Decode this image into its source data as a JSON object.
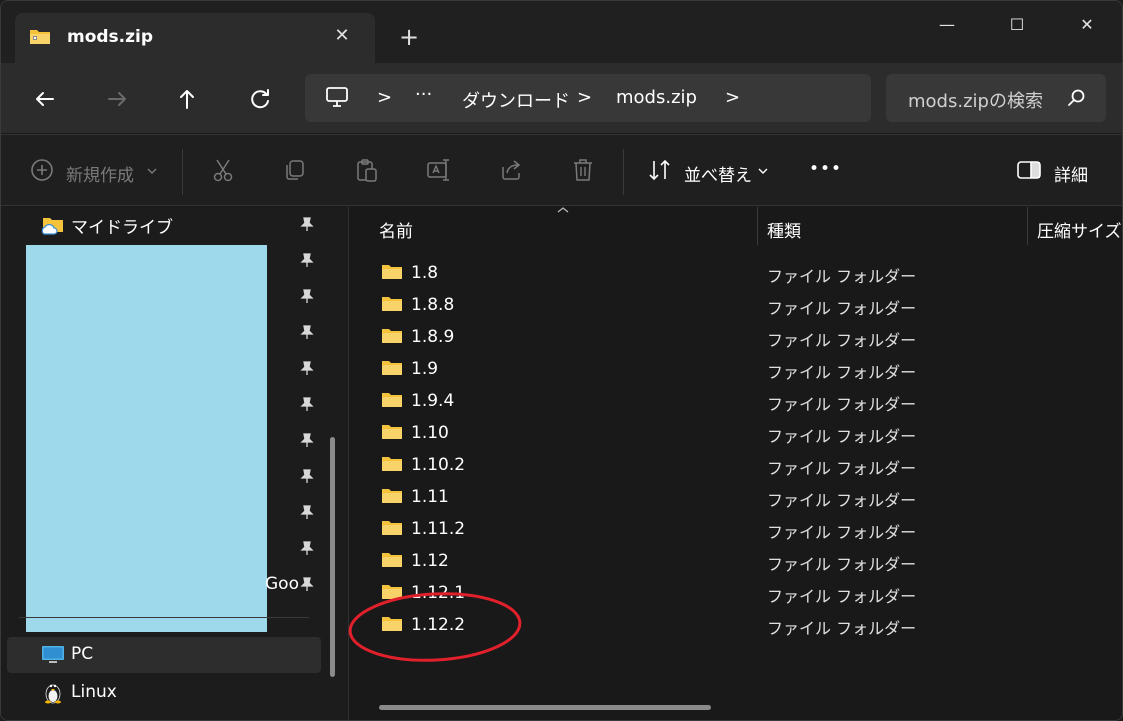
{
  "window": {
    "tab_title": "mods.zip",
    "tab_close": "✕",
    "new_tab": "+",
    "minimize": "—",
    "maximize": "☐",
    "close": "✕"
  },
  "address": {
    "ellipsis": "···",
    "crumbs": [
      "ダウンロード",
      "mods.zip"
    ],
    "separator": ">"
  },
  "search": {
    "placeholder": "mods.zipの検索"
  },
  "toolbar": {
    "new_label": "新規作成",
    "sort_label": "並べ替え",
    "more_label": "•••",
    "details_label": "詳細"
  },
  "sidebar": {
    "items": [
      {
        "label": "マイドライブ"
      },
      {
        "label": "Goo"
      },
      {
        "label": "PC"
      },
      {
        "label": "Linux"
      }
    ]
  },
  "columns": {
    "name": "名前",
    "type": "種類",
    "compressed_size": "圧縮サイズ"
  },
  "files": [
    {
      "name": "1.8",
      "type": "ファイル フォルダー"
    },
    {
      "name": "1.8.8",
      "type": "ファイル フォルダー"
    },
    {
      "name": "1.8.9",
      "type": "ファイル フォルダー"
    },
    {
      "name": "1.9",
      "type": "ファイル フォルダー"
    },
    {
      "name": "1.9.4",
      "type": "ファイル フォルダー"
    },
    {
      "name": "1.10",
      "type": "ファイル フォルダー"
    },
    {
      "name": "1.10.2",
      "type": "ファイル フォルダー"
    },
    {
      "name": "1.11",
      "type": "ファイル フォルダー"
    },
    {
      "name": "1.11.2",
      "type": "ファイル フォルダー"
    },
    {
      "name": "1.12",
      "type": "ファイル フォルダー"
    },
    {
      "name": "1.12.1",
      "type": "ファイル フォルダー"
    },
    {
      "name": "1.12.2",
      "type": "ファイル フォルダー"
    }
  ],
  "colors": {
    "folder": "#f5c33b",
    "annotation": "#e0202a",
    "redaction": "#9dd9ea"
  }
}
